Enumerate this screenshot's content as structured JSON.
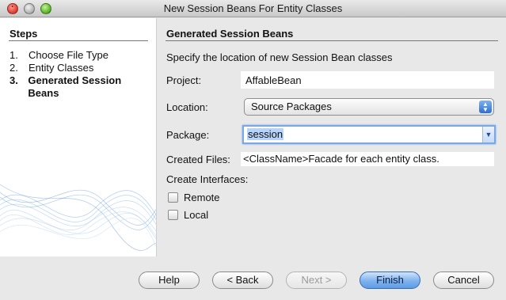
{
  "window": {
    "title": "New Session Beans For Entity Classes"
  },
  "steps": {
    "heading": "Steps",
    "items": [
      {
        "num": "1.",
        "label": "Choose File Type",
        "current": false
      },
      {
        "num": "2.",
        "label": "Entity Classes",
        "current": false
      },
      {
        "num": "3.",
        "label": "Generated Session Beans",
        "current": true
      }
    ]
  },
  "panel": {
    "heading": "Generated Session Beans",
    "description": "Specify the location of new Session Bean classes",
    "project_label": "Project:",
    "project_value": "AffableBean",
    "location_label": "Location:",
    "location_value": "Source Packages",
    "package_label": "Package:",
    "package_value": "session",
    "created_files_label": "Created Files:",
    "created_files_value": "<ClassName>Facade for each entity class.",
    "interfaces_label": "Create Interfaces:",
    "remote_label": "Remote",
    "local_label": "Local",
    "remote_checked": false,
    "local_checked": false
  },
  "buttons": {
    "help": "Help",
    "back": "< Back",
    "next": "Next >",
    "finish": "Finish",
    "cancel": "Cancel"
  },
  "colors": {
    "accent": "#5e9be6",
    "selection": "#b5d3fb"
  }
}
